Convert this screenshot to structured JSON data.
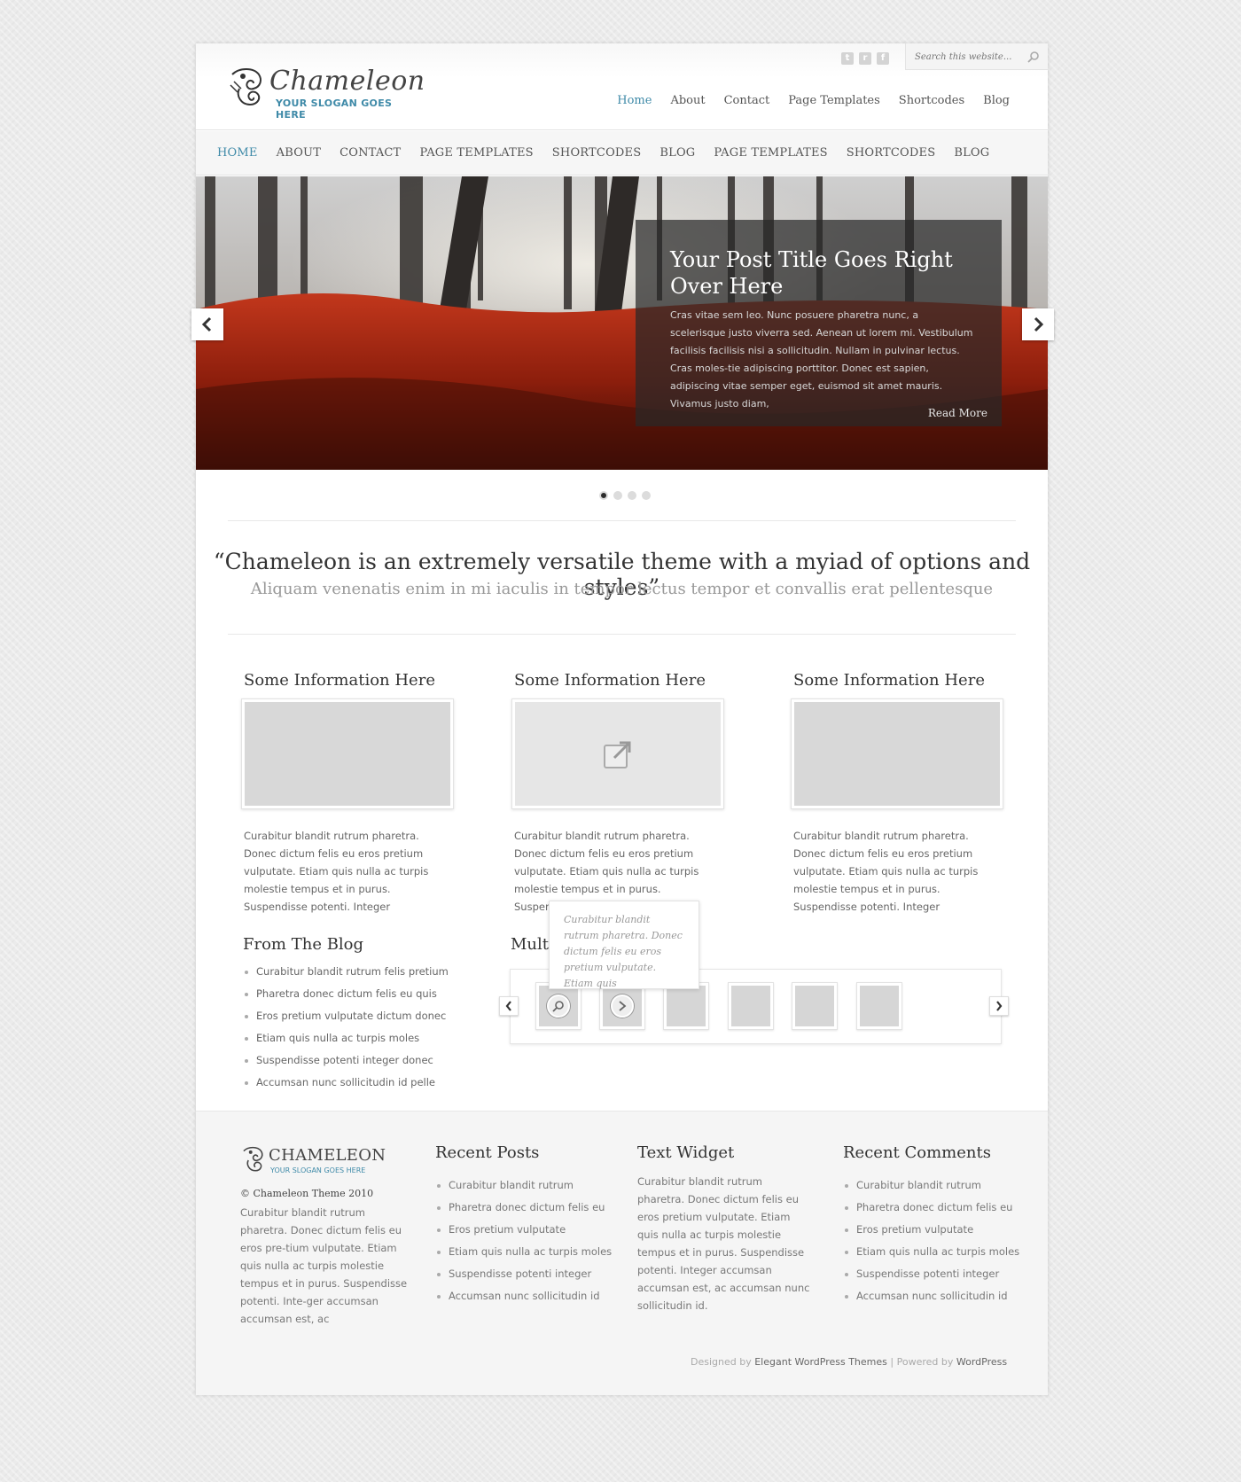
{
  "header": {
    "logo_name": "Chameleon",
    "logo_slogan": "YOUR SLOGAN GOES HERE",
    "search_placeholder": "Search this website...",
    "social": [
      {
        "label": "t"
      },
      {
        "label": "r"
      },
      {
        "label": "f"
      }
    ],
    "top_nav": [
      "Home",
      "About",
      "Contact",
      "Page Templates",
      "Shortcodes",
      "Blog"
    ]
  },
  "category_nav": [
    "HOME",
    "ABOUT",
    "CONTACT",
    "PAGE TEMPLATES",
    "SHORTCODES",
    "BLOG",
    "PAGE TEMPLATES",
    "SHORTCODES",
    "BLOG"
  ],
  "slider": {
    "title": "Your Post Title Goes Right Over Here",
    "excerpt": "Cras vitae sem leo. Nunc posuere pharetra nunc, a scelerisque justo viverra sed. Aenean ut lorem mi. Vestibulum facilisis facilisis nisi a sollicitudin. Nullam in pulvinar lectus. Cras moles-tie adipiscing porttitor. Donec est sapien, adipiscing vitae semper eget, euismod sit amet mauris. Vivamus justo diam,",
    "read_more": "Read More",
    "active_slide": 1,
    "slide_count": 4
  },
  "quote": {
    "text": "“Chameleon is an extremely versatile theme with a myiad of options and styles”",
    "subtext": "Aliquam venenatis enim in mi iaculis in tempor lectus tempor et convallis erat pellentesque"
  },
  "info_boxes": [
    {
      "title": "Some Information Here",
      "text": "Curabitur blandit rutrum pharetra. Donec dictum felis eu eros pretium vulputate. Etiam quis nulla ac turpis molestie tempus et in purus. Suspendisse potenti. Integer"
    },
    {
      "title": "Some Information Here",
      "text": "Curabitur blandit rutrum pharetra. Donec dictum felis eu eros pretium vulputate. Etiam quis nulla ac turpis molestie tempus et in purus. Suspendisse potenti. Integer"
    },
    {
      "title": "Some Information Here",
      "text": "Curabitur blandit rutrum pharetra. Donec dictum felis eu eros pretium vulputate. Etiam quis nulla ac turpis molestie tempus et in purus. Suspendisse potenti. Integer"
    }
  ],
  "blog": {
    "title": "From The Blog",
    "items": [
      "Curabitur blandit rutrum felis pretium",
      "Pharetra donec dictum felis eu quis",
      "Eros pretium vulputate dictum donec",
      "Etiam quis nulla ac turpis moles",
      "Suspendisse potenti integer donec",
      "Accumsan nunc sollicitudin id pelle"
    ]
  },
  "multimedia": {
    "title": "Multi",
    "tooltip": "Curabitur blandit rutrum pharetra. Donec dictum felis eu eros pretium vulputate. Etiam quis"
  },
  "footer": {
    "logo_name": "CHAMELEON",
    "logo_slogan": "YOUR SLOGAN GOES HERE",
    "copyright": "© Chameleon Theme 2010",
    "about": "Curabitur blandit rutrum pharetra. Donec dictum felis eu eros pre-tium vulputate. Etiam quis nulla ac turpis molestie tempus et in purus. Suspendisse potenti. Inte-ger accumsan accumsan est, ac",
    "recent_posts": {
      "title": "Recent Posts",
      "items": [
        "Curabitur blandit rutrum",
        "Pharetra donec dictum felis eu",
        "Eros pretium vulputate",
        "Etiam quis nulla ac turpis moles",
        "Suspendisse potenti integer",
        "Accumsan nunc sollicitudin id"
      ]
    },
    "text_widget": {
      "title": "Text Widget",
      "text": "Curabitur blandit rutrum pharetra. Donec dictum felis eu eros pretium vulputate. Etiam quis nulla ac turpis molestie tempus et in purus. Suspendisse potenti. Integer accumsan accumsan est, ac accumsan nunc sollicitudin id."
    },
    "recent_comments": {
      "title": "Recent Comments",
      "items": [
        "Curabitur blandit rutrum",
        "Pharetra donec dictum felis eu",
        "Eros pretium vulputate",
        "Etiam quis nulla ac turpis moles",
        "Suspendisse potenti integer",
        "Accumsan nunc sollicitudin id"
      ]
    },
    "credits": {
      "designed_by": "Designed by",
      "designer": "Elegant WordPress Themes",
      "separator": "|",
      "powered_by": "Powered by",
      "platform": "WordPress"
    }
  },
  "colors": {
    "accent": "#3f8aa8",
    "background": "#ebebeb"
  }
}
